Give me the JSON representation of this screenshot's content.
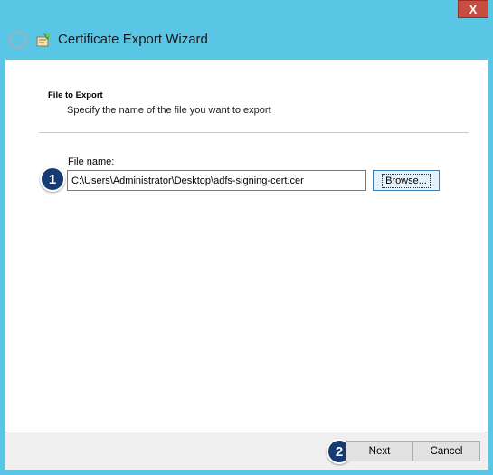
{
  "window": {
    "title": "Certificate Export Wizard",
    "close_glyph": "X",
    "back_glyph": "←",
    "icons": {
      "back": "back-arrow-icon",
      "wizard": "certificate-wizard-icon",
      "close": "close-icon"
    }
  },
  "section": {
    "title": "File to Export",
    "subtitle": "Specify the name of the file you want to export"
  },
  "file_field": {
    "label": "File name:",
    "value": "C:\\Users\\Administrator\\Desktop\\adfs-signing-cert.cer"
  },
  "buttons": {
    "browse": "Browse...",
    "next": "Next",
    "cancel": "Cancel"
  },
  "callouts": {
    "step1": "1",
    "step2": "2"
  },
  "colors": {
    "frame": "#59c6e6",
    "close": "#c74d41",
    "badge": "#163a72"
  }
}
